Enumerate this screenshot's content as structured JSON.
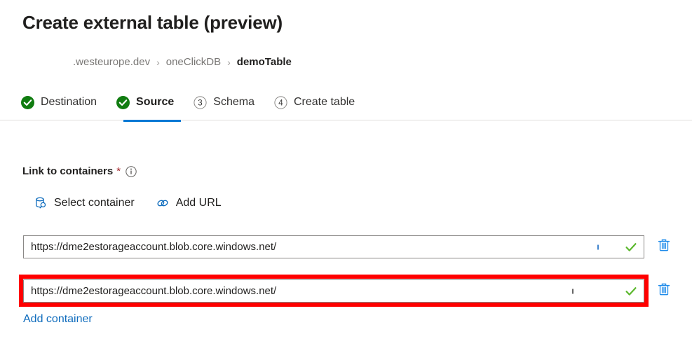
{
  "page": {
    "title": "Create external table (preview)"
  },
  "breadcrumb": {
    "separator": "›",
    "items": [
      {
        "label": ".westeurope.dev",
        "current": false
      },
      {
        "label": "oneClickDB",
        "current": false
      },
      {
        "label": "demoTable",
        "current": true
      }
    ]
  },
  "steps": [
    {
      "label": "Destination",
      "state": "complete",
      "marker": "check-circle-icon",
      "number": "1",
      "active": false
    },
    {
      "label": "Source",
      "state": "complete",
      "marker": "check-circle-icon",
      "number": "2",
      "active": true
    },
    {
      "label": "Schema",
      "state": "pending",
      "marker": "numbered-circle-icon",
      "number": "3",
      "active": false
    },
    {
      "label": "Create table",
      "state": "pending",
      "marker": "numbered-circle-icon",
      "number": "4",
      "active": false
    }
  ],
  "form": {
    "label": "Link to containers",
    "required_marker": "*",
    "info_icon": "info-icon"
  },
  "commandbar": {
    "select_container": {
      "label": "Select container",
      "icon": "container-search-icon"
    },
    "add_url": {
      "label": "Add URL",
      "icon": "link-icon"
    }
  },
  "containers": [
    {
      "value": "https://dme2estorageaccount.blob.core.windows.net/",
      "placeholder": "https://",
      "valid": true,
      "valid_icon": "green-check-icon",
      "delete_icon": "trash-icon",
      "highlighted": false
    },
    {
      "value": "https://dme2estorageaccount.blob.core.windows.net/",
      "placeholder": "https://",
      "valid": true,
      "valid_icon": "green-check-icon",
      "delete_icon": "trash-icon",
      "highlighted": true
    }
  ],
  "add_container_link": "Add container",
  "colors": {
    "accent": "#0078d4",
    "link": "#0f6cbd",
    "success": "#107c10",
    "valid_check": "#5cb82e",
    "required": "#a4262c",
    "annotation": "#ff0000"
  }
}
